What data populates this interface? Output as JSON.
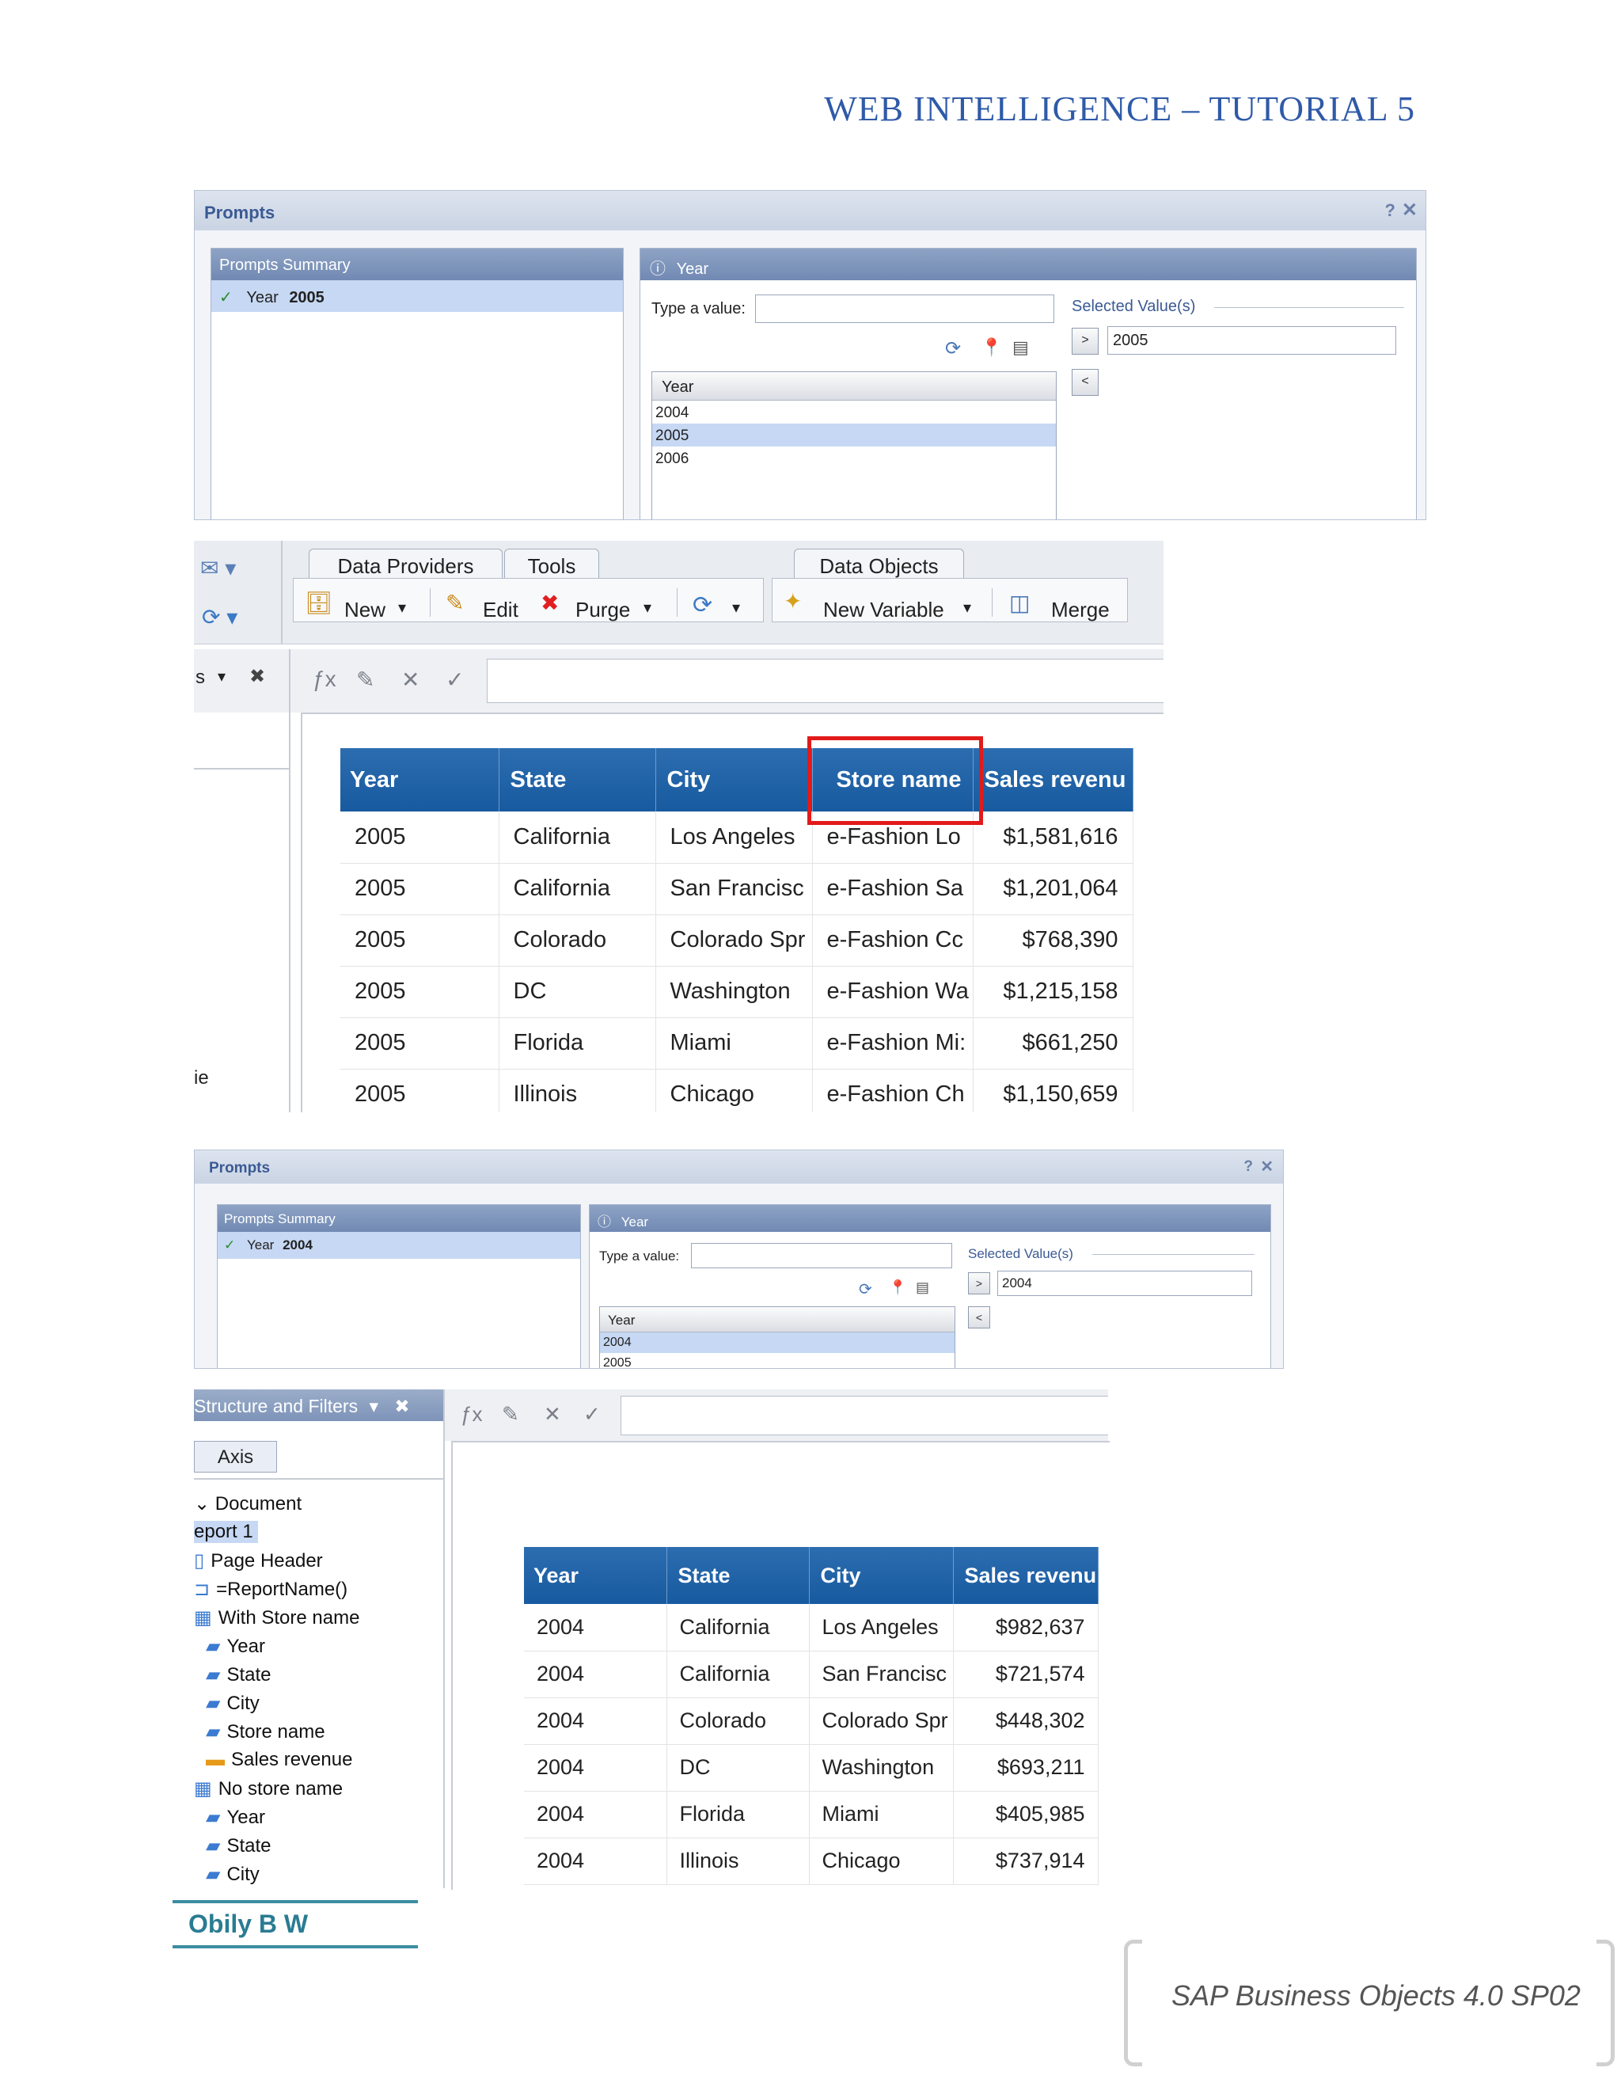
{
  "header": {
    "title": "WEB INTELLIGENCE – TUTORIAL 5"
  },
  "footer": {
    "author": "Obily B W",
    "product": "SAP Business Objects 4.0 SP02"
  },
  "prompts1": {
    "title": "Prompts",
    "summary_header": "Prompts Summary",
    "summary_item_name": "Year",
    "summary_item_value": "2005",
    "prompt_header": "Year",
    "type_label": "Type a value:",
    "list_header": "Year",
    "list_items": [
      "2004",
      "2005",
      "2006"
    ],
    "selected_index": 1,
    "selected_values_label": "Selected Value(s)",
    "selected_value": "2005",
    "add_btn": ">",
    "remove_btn": "<"
  },
  "toolbar": {
    "tabs": [
      "Data Providers",
      "Tools",
      "Data Objects"
    ],
    "new_label": "New",
    "edit_label": "Edit",
    "purge_label": "Purge",
    "new_variable_label": "New Variable",
    "merge_label": "Merge"
  },
  "table1": {
    "columns": [
      "Year",
      "State",
      "City",
      "Store name",
      "Sales revenu"
    ],
    "rows": [
      [
        "2005",
        "California",
        "Los Angeles",
        "e-Fashion Lo",
        "$1,581,616"
      ],
      [
        "2005",
        "California",
        "San Francisc",
        "e-Fashion Sa",
        "$1,201,064"
      ],
      [
        "2005",
        "Colorado",
        "Colorado Spr",
        "e-Fashion Cc",
        "$768,390"
      ],
      [
        "2005",
        "DC",
        "Washington",
        "e-Fashion Wa",
        "$1,215,158"
      ],
      [
        "2005",
        "Florida",
        "Miami",
        "e-Fashion Mi:",
        "$661,250"
      ],
      [
        "2005",
        "Illinois",
        "Chicago",
        "e-Fashion Ch",
        "$1,150,659"
      ]
    ],
    "side_text_1": "s",
    "side_text_2": "ie"
  },
  "prompts2": {
    "title": "Prompts",
    "summary_header": "Prompts Summary",
    "summary_item_name": "Year",
    "summary_item_value": "2004",
    "prompt_header": "Year",
    "type_label": "Type a value:",
    "list_header": "Year",
    "list_items": [
      "2004",
      "2005"
    ],
    "selected_index": 0,
    "selected_values_label": "Selected Value(s)",
    "selected_value": "2004",
    "add_btn": ">",
    "remove_btn": "<"
  },
  "structure": {
    "header": "Structure and Filters",
    "axis_label": "Axis",
    "items": [
      "Document",
      "eport 1",
      "Page Header",
      "=ReportName()",
      "With Store name",
      "Year",
      "State",
      "City",
      "Store name",
      "Sales revenue",
      "No store name",
      "Year",
      "State",
      "City"
    ]
  },
  "table2": {
    "columns": [
      "Year",
      "State",
      "City",
      "Sales revenu"
    ],
    "rows": [
      [
        "2004",
        "California",
        "Los Angeles",
        "$982,637"
      ],
      [
        "2004",
        "California",
        "San Francisc",
        "$721,574"
      ],
      [
        "2004",
        "Colorado",
        "Colorado Spr",
        "$448,302"
      ],
      [
        "2004",
        "DC",
        "Washington",
        "$693,211"
      ],
      [
        "2004",
        "Florida",
        "Miami",
        "$405,985"
      ],
      [
        "2004",
        "Illinois",
        "Chicago",
        "$737,914"
      ]
    ]
  },
  "colors": {
    "header_blue": "#2f5aa8",
    "table_header": "#1f63a8",
    "highlight": "#e11a1a",
    "author": "#2a7c92"
  }
}
